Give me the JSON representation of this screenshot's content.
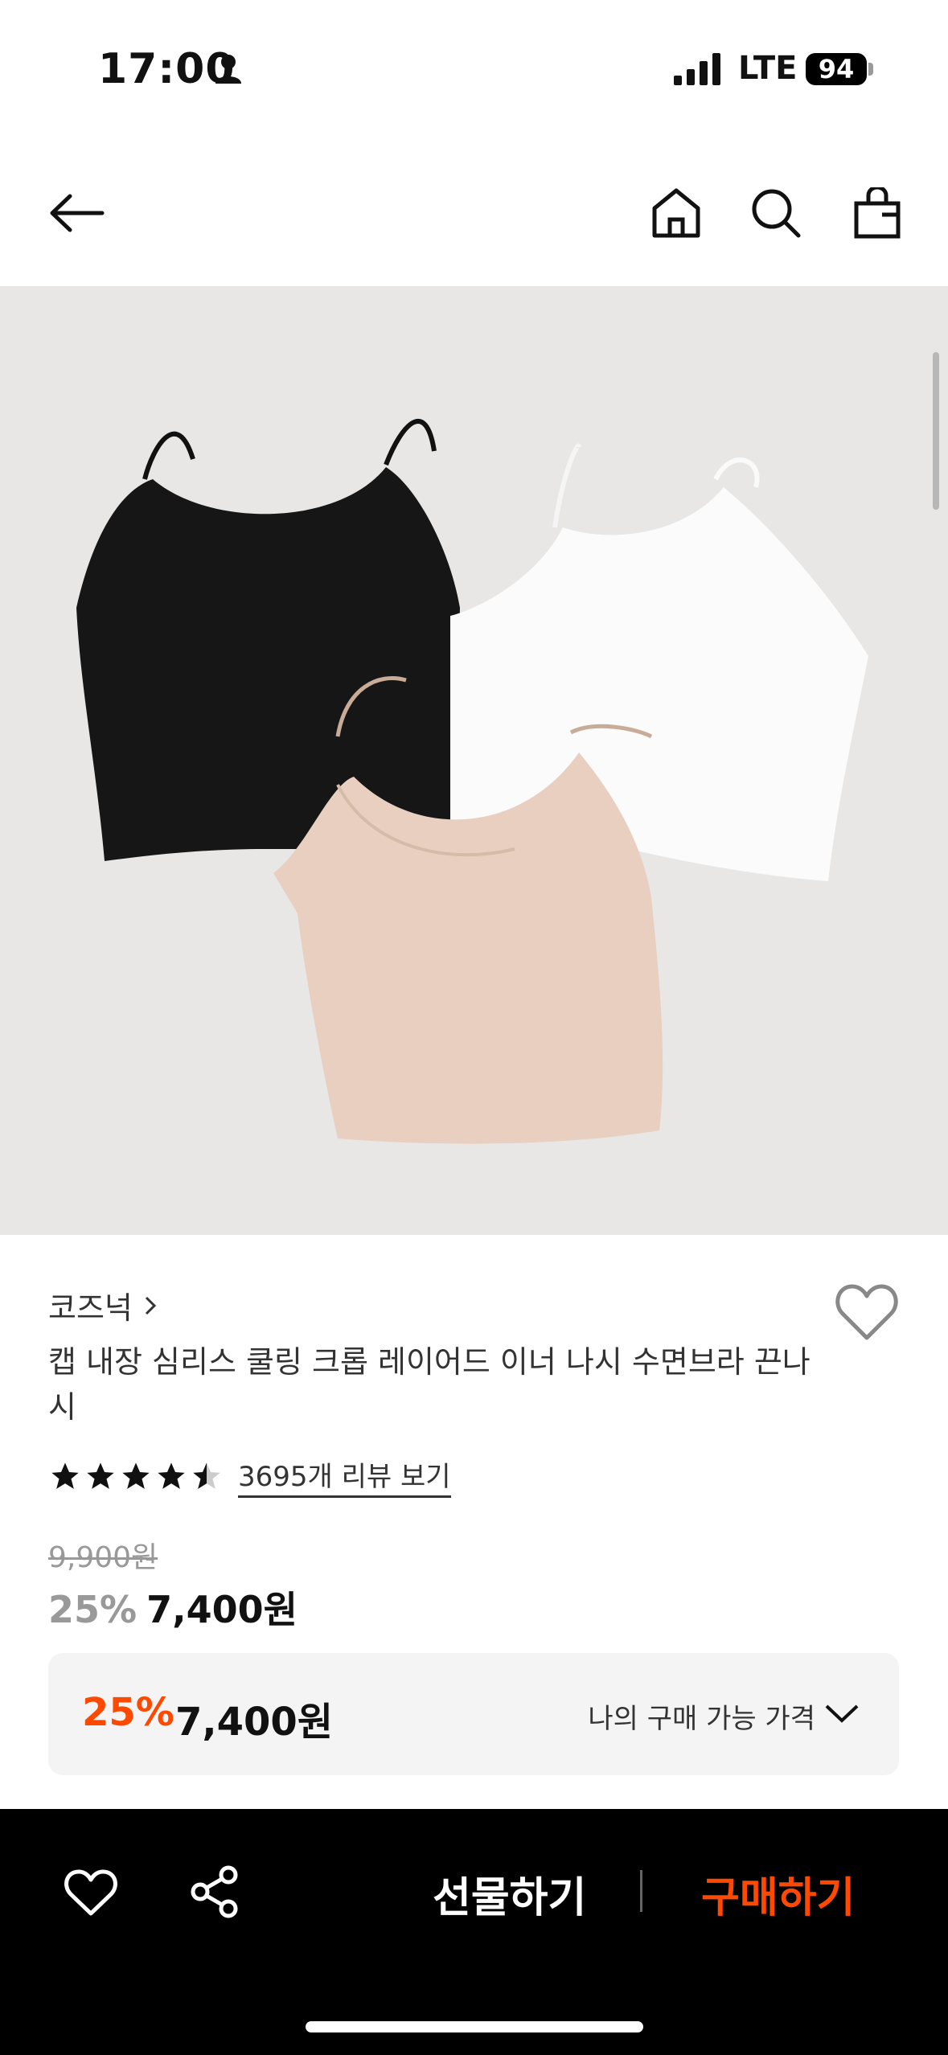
{
  "status_bar": {
    "time": "17:00",
    "network": "LTE",
    "battery": "94"
  },
  "nav": {
    "icons": [
      "back-arrow-icon",
      "home-icon",
      "search-icon",
      "shopping-bag-icon"
    ]
  },
  "product": {
    "brand": "코즈넉",
    "title": "캡 내장 심리스 쿨링 크롭 레이어드 이너 나시 수면브라 끈나시",
    "rating": 4.5,
    "review_link": "3695개 리뷰 보기",
    "original_price": "9,900원",
    "discount": "25%",
    "price": "7,400원"
  },
  "my_price": {
    "discount": "25%",
    "price": "7,400원",
    "label": "나의 구매 가능 가격"
  },
  "bottom_bar": {
    "gift_label": "선물하기",
    "buy_label": "구매하기"
  },
  "colors": {
    "accent": "#ff4800",
    "bar_bg": "#000000",
    "hero_bg": "#e8e7e6"
  }
}
